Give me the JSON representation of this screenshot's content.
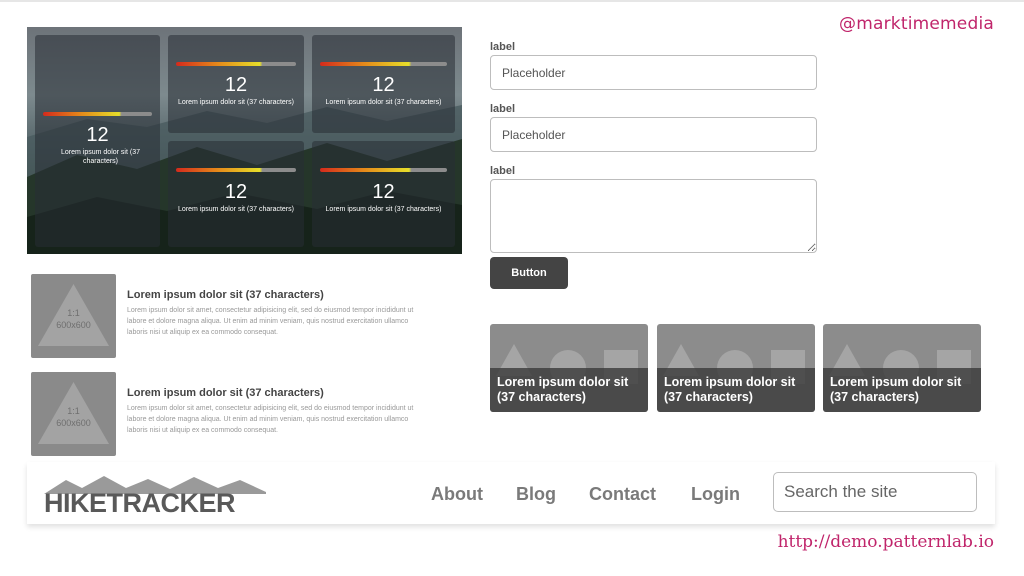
{
  "handle": "@marktimemedia",
  "url": "http://demo.patternlab.io",
  "dashboard": {
    "tiles": [
      {
        "value": "12",
        "caption": "Lorem ipsum dolor sit (37 characters)"
      },
      {
        "value": "12",
        "caption": "Lorem ipsum dolor sit (37 characters)"
      },
      {
        "value": "12",
        "caption": "Lorem ipsum dolor sit (37 characters)"
      },
      {
        "value": "12",
        "caption": "Lorem ipsum dolor sit (37 characters)"
      },
      {
        "value": "12",
        "caption": "Lorem ipsum dolor sit (37 characters)"
      }
    ]
  },
  "form": {
    "fields": [
      {
        "label": "label",
        "placeholder": "Placeholder"
      },
      {
        "label": "label",
        "placeholder": "Placeholder"
      },
      {
        "label": "label"
      }
    ],
    "button": "Button"
  },
  "media_list": [
    {
      "thumb_ratio": "1:1",
      "thumb_size": "600x600",
      "title": "Lorem ipsum dolor sit (37 characters)",
      "body": "Lorem ipsum dolor sit amet, consectetur adipisicing elit, sed do eiusmod tempor incididunt ut labore et dolore magna aliqua. Ut enim ad minim veniam, quis nostrud exercitation ullamco laboris nisi ut aliquip ex ea commodo consequat."
    },
    {
      "thumb_ratio": "1:1",
      "thumb_size": "600x600",
      "title": "Lorem ipsum dolor sit (37 characters)",
      "body": "Lorem ipsum dolor sit amet, consectetur adipisicing elit, sed do eiusmod tempor incididunt ut labore et dolore magna aliqua. Ut enim ad minim veniam, quis nostrud exercitation ullamco laboris nisi ut aliquip ex ea commodo consequat."
    }
  ],
  "cards": [
    {
      "title": "Lorem ipsum dolor sit (37 characters)"
    },
    {
      "title": "Lorem ipsum dolor sit (37 characters)"
    },
    {
      "title": "Lorem ipsum dolor sit (37 characters)"
    }
  ],
  "header": {
    "logo": "HIKETRACKER",
    "nav": [
      "About",
      "Blog",
      "Contact",
      "Login"
    ],
    "search_placeholder": "Search the site"
  },
  "colors": {
    "accent": "#c0256b",
    "button": "#444444",
    "placeholder_gray": "#8c8c8c"
  }
}
